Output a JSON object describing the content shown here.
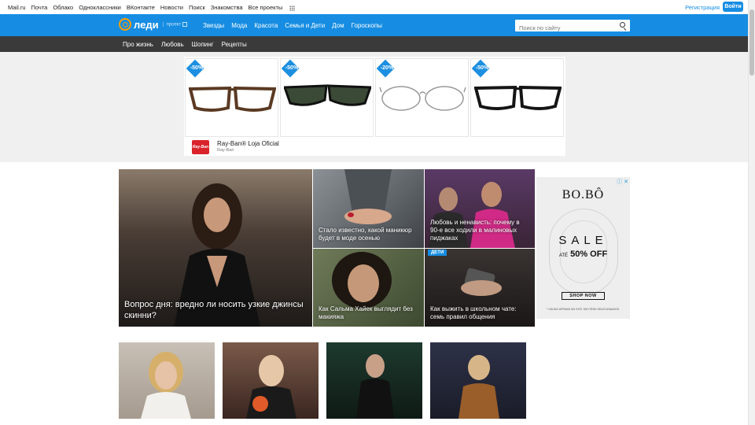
{
  "portal": {
    "links": [
      "Mail.ru",
      "Почта",
      "Облако",
      "Одноклассники",
      "ВКонтакте",
      "Новости",
      "Поиск",
      "Знакомства",
      "Все проекты"
    ],
    "register": "Регистрация",
    "login": "Войти"
  },
  "header": {
    "logo": "леди",
    "project": "проект",
    "nav": [
      "Звезды",
      "Мода",
      "Красота",
      "Семья и Дети",
      "Дом",
      "Гороскопы"
    ],
    "search_placeholder": "Поиск по сайту"
  },
  "subnav": [
    "Про жизнь",
    "Любовь",
    "Шопинг",
    "Рецепты"
  ],
  "ad": {
    "products": [
      {
        "badge": "-50%",
        "frame_color": "#5a3a22",
        "lens": "none",
        "icon": "glasses-icon"
      },
      {
        "badge": "-50%",
        "frame_color": "#111111",
        "lens": "dark-green",
        "icon": "sunglasses-icon"
      },
      {
        "badge": "-20%",
        "frame_color": "#9a9a9a",
        "lens": "none",
        "icon": "glasses-icon"
      },
      {
        "badge": "-50%",
        "frame_color": "#151515",
        "lens": "none",
        "icon": "glasses-icon"
      }
    ],
    "advertiser": "Ray-Ban® Loja Oficial",
    "advertiser_sub": "Ray-Ban",
    "logo_text": "Ray-Ban"
  },
  "features": [
    {
      "caption": "Вопрос дня: вредно ли носить узкие джинсы скинни?",
      "bg": "#3a3430"
    },
    {
      "caption": "Стало известно, какой маникюр будет в моде осенью",
      "bg": "#6e7378"
    },
    {
      "caption": "Любовь и ненависть: почему в 90-е все ходили в малиновых пиджаках",
      "bg": "#4a2a44"
    },
    {
      "caption": "Как Сальма Хайек выглядит без макияжа",
      "bg": "#4d5a40"
    },
    {
      "caption": "Как выжить в школьном чате: семь правил общения",
      "bg": "#2a2624",
      "tag": "ДЕТИ"
    }
  ],
  "banner": {
    "brand": "BO.BÔ",
    "sale": "SALE",
    "pct_prefix": "ATÉ",
    "pct": "50% OFF",
    "shop": "SHOP NOW",
    "fine": "* VÁLIDO APENAS NO SITE. EM ITENS SELECIONADOS."
  },
  "cards": [
    {
      "bg": "#b8b0a8"
    },
    {
      "bg": "#5c4236"
    },
    {
      "bg": "#1d2a24"
    },
    {
      "bg": "#34384a"
    }
  ]
}
